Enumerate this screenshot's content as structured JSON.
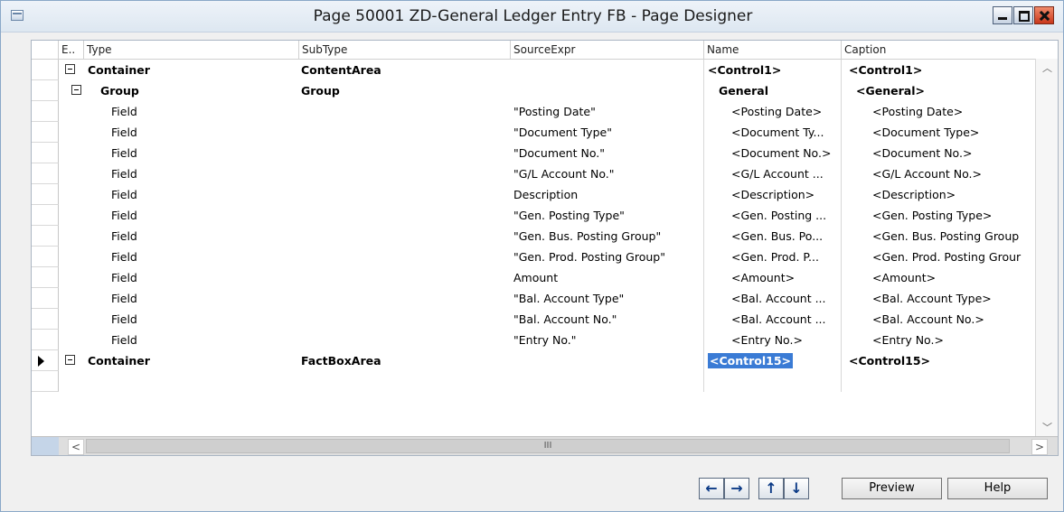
{
  "window": {
    "title": "Page 50001 ZD-General Ledger Entry FB - Page Designer",
    "app_icon": "page-designer-icon",
    "controls": [
      "minimize",
      "maximize",
      "close"
    ]
  },
  "grid": {
    "headers": {
      "expand": "E..",
      "type": "Type",
      "subtype": "SubType",
      "source": "SourceExpr",
      "name": "Name",
      "caption": "Caption"
    },
    "rows": [
      {
        "expander": true,
        "indent": 0,
        "bold": true,
        "type": "Container",
        "subtype": "ContentArea",
        "source": "",
        "name": "<Control1>",
        "caption": "<Control1>"
      },
      {
        "expander": true,
        "indent": 1,
        "bold": true,
        "type": "Group",
        "subtype": "Group",
        "source": "",
        "name": "General",
        "caption": "<General>"
      },
      {
        "type": "Field",
        "source": "\"Posting Date\"",
        "name": "<Posting Date>",
        "caption": "<Posting Date>"
      },
      {
        "type": "Field",
        "source": "\"Document Type\"",
        "name": "<Document Ty...",
        "caption": "<Document Type>"
      },
      {
        "type": "Field",
        "source": "\"Document No.\"",
        "name": "<Document No.>",
        "caption": "<Document No.>"
      },
      {
        "type": "Field",
        "source": "\"G/L Account No.\"",
        "name": "<G/L Account ...",
        "caption": "<G/L Account No.>"
      },
      {
        "type": "Field",
        "source": "Description",
        "name": "<Description>",
        "caption": "<Description>"
      },
      {
        "type": "Field",
        "source": "\"Gen. Posting Type\"",
        "name": "<Gen. Posting ...",
        "caption": "<Gen. Posting Type>"
      },
      {
        "type": "Field",
        "source": "\"Gen. Bus. Posting Group\"",
        "name": "<Gen. Bus. Po...",
        "caption": "<Gen. Bus. Posting Group"
      },
      {
        "type": "Field",
        "source": "\"Gen. Prod. Posting Group\"",
        "name": "<Gen. Prod. P...",
        "caption": "<Gen. Prod. Posting Grour"
      },
      {
        "type": "Field",
        "source": "Amount",
        "name": "<Amount>",
        "caption": "<Amount>"
      },
      {
        "type": "Field",
        "source": "\"Bal. Account Type\"",
        "name": "<Bal. Account ...",
        "caption": "<Bal. Account Type>"
      },
      {
        "type": "Field",
        "source": "\"Bal. Account No.\"",
        "name": "<Bal. Account ...",
        "caption": "<Bal. Account No.>"
      },
      {
        "type": "Field",
        "source": "\"Entry No.\"",
        "name": "<Entry No.>",
        "caption": "<Entry No.>"
      },
      {
        "expander": true,
        "indent": 0,
        "bold": true,
        "current": true,
        "selected_name": true,
        "type": "Container",
        "subtype": "FactBoxArea",
        "source": "",
        "name": "<Control15>",
        "caption": "<Control15>"
      },
      {
        "type": "",
        "source": "",
        "name": "",
        "caption": ""
      }
    ],
    "scroll_thumb_label": "III"
  },
  "footer": {
    "nav": [
      {
        "id": "left",
        "glyph": "←"
      },
      {
        "id": "right",
        "glyph": "→"
      },
      {
        "id": "up",
        "glyph": "↑"
      },
      {
        "id": "down",
        "glyph": "↓"
      }
    ],
    "preview_label": "Preview",
    "help_label": "Help"
  }
}
